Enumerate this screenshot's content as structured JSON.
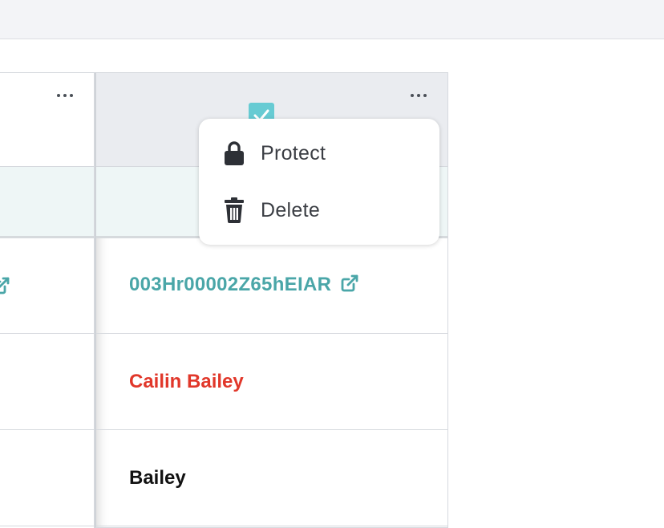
{
  "colors": {
    "accent_teal": "#4aa6a8",
    "name_red": "#e1372a",
    "checkbox": "#67cbd3"
  },
  "columns": {
    "left": {
      "menu_icon": "more-horizontal-icon",
      "row_icon": "external-link-icon"
    },
    "right": {
      "menu_icon": "more-horizontal-icon",
      "header_checkbox": "checked",
      "rows": [
        {
          "text": "003Hr00002Z65hEIAR",
          "icon": "external-link-icon"
        },
        {
          "text": "Cailin Bailey"
        },
        {
          "text": "Bailey"
        }
      ]
    }
  },
  "context_menu": {
    "items": [
      {
        "label": "Protect",
        "icon": "lock-icon"
      },
      {
        "label": "Delete",
        "icon": "trash-icon"
      }
    ]
  }
}
